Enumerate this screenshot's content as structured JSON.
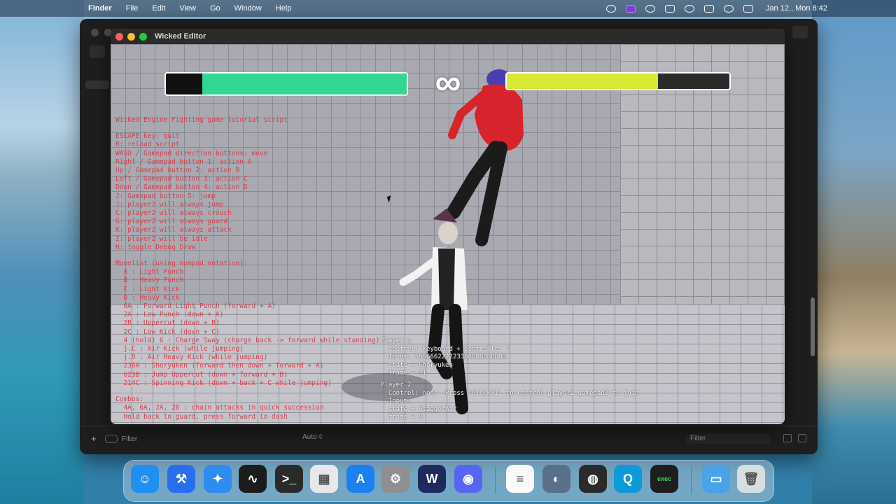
{
  "menubar": {
    "app": "Finder",
    "items": [
      "File",
      "Edit",
      "View",
      "Go",
      "Window",
      "Help"
    ],
    "clock": "Jan 12., Mon  8:42"
  },
  "bg_window": {
    "bottom_filter_placeholder": "Filter",
    "auto_label": "Auto ◊",
    "right_filter_placeholder": "Filter"
  },
  "game_window": {
    "title": "Wicked Editor",
    "hud": {
      "player1_health": 0.85,
      "player2_health": 0.68,
      "timer_symbol": "∞",
      "colors": {
        "p1": "#33d690",
        "p2": "#d8e833"
      }
    },
    "debug_lines": [
      "Wicked Engine Fighting game tutorial script",
      "",
      "ESCAPE key: quit",
      "R: reload script",
      "WASD / Gamepad direction buttons: move",
      "Right / Gamepad button 1: action A",
      "Up / Gamepad button 2: action B",
      "Left / Gamepad button 3: action C",
      "Down / Gamepad button 4: action D",
      "J: Gamepad button 5: jump",
      "J: player2 will always jump",
      "C: player2 will always crouch",
      "G: player2 will always guard",
      "K: player2 will always attack",
      "I: player2 will be idle",
      "H: toggle Debug Draw",
      "",
      "Movelist (using numpad notation):",
      "  A : Light Punch",
      "  B : Heavy Punch",
      "  C : Light Kick",
      "  D : Heavy Kick",
      "  6A : Forward Light Punch (forward + A)",
      "  2A : Low Punch (down + A)",
      "  2B : Uppercut (down + B)",
      "  2C : Low Kick (down + C)",
      "  4 (hold) 6 : Charge Sway (charge back -> forward while standing)",
      "  j.C : Air Kick (while jumping)",
      "  j.D : Air Heavy Kick (while jumping)",
      "  236A : Shoryuken (forward then down + forward + A)",
      "  623B : Jump Uppercut (down + forward + B)",
      "  214C : Spinning Kick (down + back + C while jumping)",
      "",
      "Combos:",
      "  4A, 6A, 2A, 2B : chain attacks in quick succession",
      "  Hold back to guard, press forward to dash"
    ],
    "player1_text": [
      "Player 1",
      "  Control: Keyboard + Controller 1",
      "  Input: 555666222223366BBBBBBBBB",
      "  state = Shoryuken",
      "  frame = 31"
    ],
    "player2_text": [
      "Player 2",
      "  Control: none  Press 'G/C/K/I' to control player2 gamepad2 to join",
      "  Input:",
      "  state = StaggerAir",
      "  frame = 9"
    ]
  },
  "dock": {
    "items": [
      {
        "name": "finder-dock-icon",
        "color": "#1f8ff0",
        "glyph": "☺"
      },
      {
        "name": "xcode-dock-icon",
        "color": "#2a6ef0",
        "glyph": "⚒"
      },
      {
        "name": "safari-dock-icon",
        "color": "#2d8cf0",
        "glyph": "✦"
      },
      {
        "name": "activity-monitor-dock-icon",
        "color": "#1c1c1c",
        "glyph": "∿"
      },
      {
        "name": "terminal-dock-icon",
        "color": "#2a2a2a",
        "glyph": ">_"
      },
      {
        "name": "launchpad-dock-icon",
        "color": "#e8e8ec",
        "glyph": "▦"
      },
      {
        "name": "app-store-dock-icon",
        "color": "#1c7ff2",
        "glyph": "A"
      },
      {
        "name": "system-settings-dock-icon",
        "color": "#8e8e93",
        "glyph": "⚙"
      },
      {
        "name": "wicked-dock-icon",
        "color": "#1f2a5c",
        "glyph": "W"
      },
      {
        "name": "discord-dock-icon",
        "color": "#5865f2",
        "glyph": "◉"
      },
      {
        "name": "textedit-dock-icon",
        "color": "#fafafa",
        "glyph": "≡"
      },
      {
        "name": "simulator-dock-icon",
        "color": "#5a6f8a",
        "glyph": "◐"
      },
      {
        "name": "obs-dock-icon",
        "color": "#2a2a2a",
        "glyph": "◍"
      },
      {
        "name": "quicktime-dock-icon",
        "color": "#0d9ad8",
        "glyph": "Q"
      },
      {
        "name": "exec-dock-icon",
        "color": "#1e1e1e",
        "glyph": "exec"
      },
      {
        "name": "folder-dock-icon",
        "color": "#4aa2e8",
        "glyph": "▭"
      },
      {
        "name": "trash-dock-icon",
        "color": "#d8dde2",
        "glyph": "🗑"
      }
    ]
  }
}
